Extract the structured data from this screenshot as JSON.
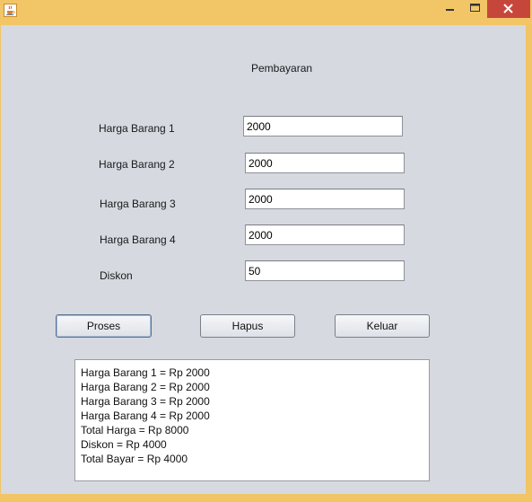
{
  "window": {
    "icon": "java-cup-icon",
    "controls": {
      "minimize": "minimize-icon",
      "maximize": "maximize-icon",
      "close": "close-icon"
    }
  },
  "form": {
    "title": "Pembayaran",
    "fields": [
      {
        "label": "Harga Barang 1",
        "value": "2000"
      },
      {
        "label": "Harga Barang 2",
        "value": "2000"
      },
      {
        "label": "Harga Barang 3",
        "value": "2000"
      },
      {
        "label": "Harga Barang 4",
        "value": "2000"
      },
      {
        "label": "Diskon",
        "value": "50"
      }
    ]
  },
  "buttons": {
    "proses": "Proses",
    "hapus": "Hapus",
    "keluar": "Keluar"
  },
  "output": {
    "lines": [
      "Harga Barang 1 = Rp 2000",
      "Harga Barang 2 = Rp 2000",
      "Harga Barang 3 = Rp 2000",
      "Harga Barang 4 = Rp 2000",
      "Total Harga = Rp 8000",
      "Diskon = Rp 4000",
      "Total Bayar = Rp 4000"
    ]
  }
}
